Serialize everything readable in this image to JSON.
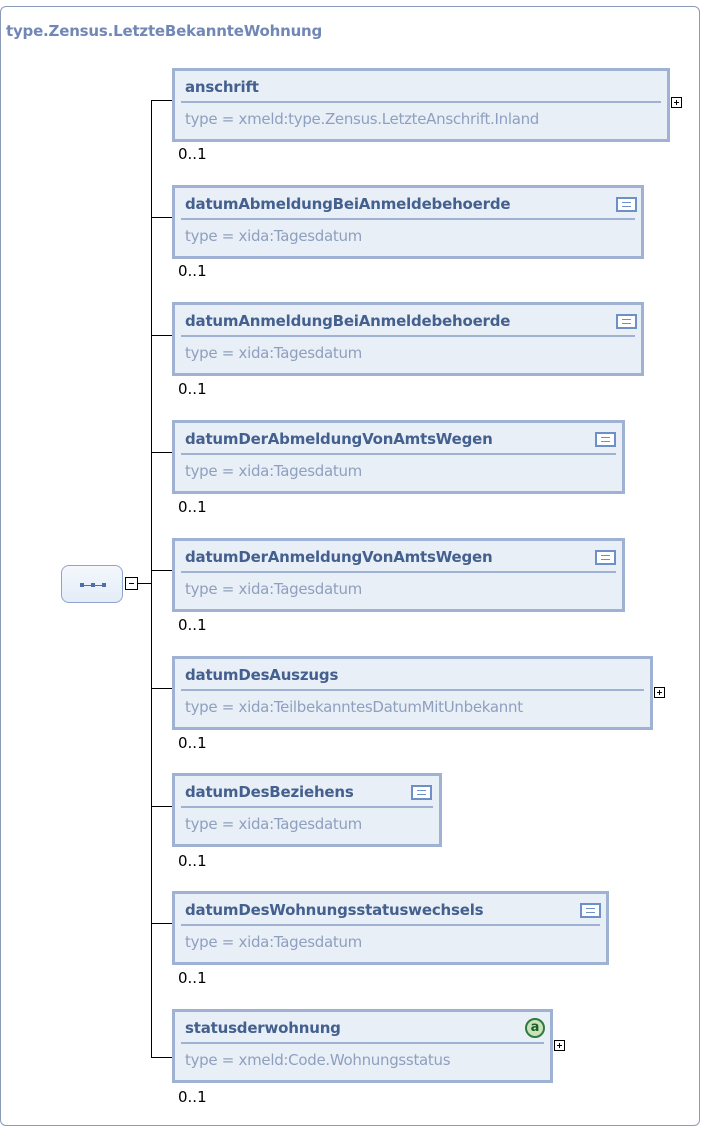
{
  "title": "type.Zensus.LetzteBekannteWohnung",
  "elements": [
    {
      "name": "anschrift",
      "type": "type = xmeld:type.Zensus.LetzteAnschrift.Inland",
      "cardinality": "0..1",
      "icon": "expand-plus-icon"
    },
    {
      "name": "datumAbmeldungBeiAnmeldebehoerde",
      "type": "type = xida:Tagesdatum",
      "cardinality": "0..1",
      "icon": "documentation-icon"
    },
    {
      "name": "datumAnmeldungBeiAnmeldebehoerde",
      "type": "type = xida:Tagesdatum",
      "cardinality": "0..1",
      "icon": "documentation-icon"
    },
    {
      "name": "datumDerAbmeldungVonAmtsWegen",
      "type": "type = xida:Tagesdatum",
      "cardinality": "0..1",
      "icon": "documentation-icon"
    },
    {
      "name": "datumDerAnmeldungVonAmtsWegen",
      "type": "type = xida:Tagesdatum",
      "cardinality": "0..1",
      "icon": "documentation-icon"
    },
    {
      "name": "datumDesAuszugs",
      "type": "type = xida:TeilbekanntesDatumMitUnbekannt",
      "cardinality": "0..1",
      "icon": "expand-plus-icon"
    },
    {
      "name": "datumDesBeziehens",
      "type": "type = xida:Tagesdatum",
      "cardinality": "0..1",
      "icon": "documentation-icon"
    },
    {
      "name": "datumDesWohnungsstatuswechsels",
      "type": "type = xida:Tagesdatum",
      "cardinality": "0..1",
      "icon": "documentation-icon"
    },
    {
      "name": "statusderwohnung",
      "type": "type = xmeld:Code.Wohnungsstatus",
      "cardinality": "0..1",
      "icon": "attribute-icon",
      "attribute_glyph": "a"
    }
  ]
}
